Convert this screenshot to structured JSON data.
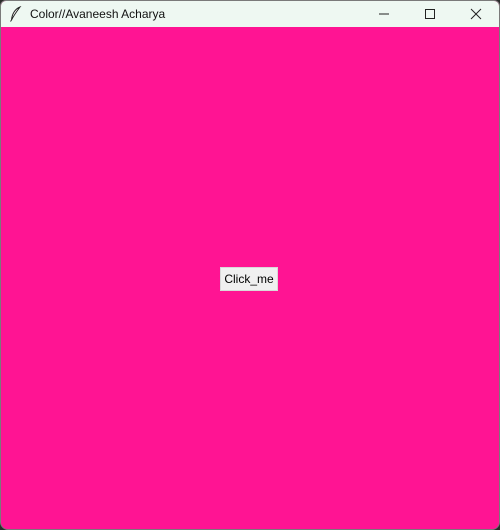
{
  "window": {
    "title": "Color//Avaneesh Acharya",
    "app_icon": "feather-icon",
    "controls": {
      "minimize_icon": "minimize-icon",
      "maximize_icon": "maximize-icon",
      "close_icon": "close-icon"
    }
  },
  "main": {
    "background_color": "#ff1493",
    "button_label": "Click_me"
  },
  "colors": {
    "titlebar": "#eef8f2",
    "canvas": "#ff1493",
    "button": "#f0f0f0"
  }
}
